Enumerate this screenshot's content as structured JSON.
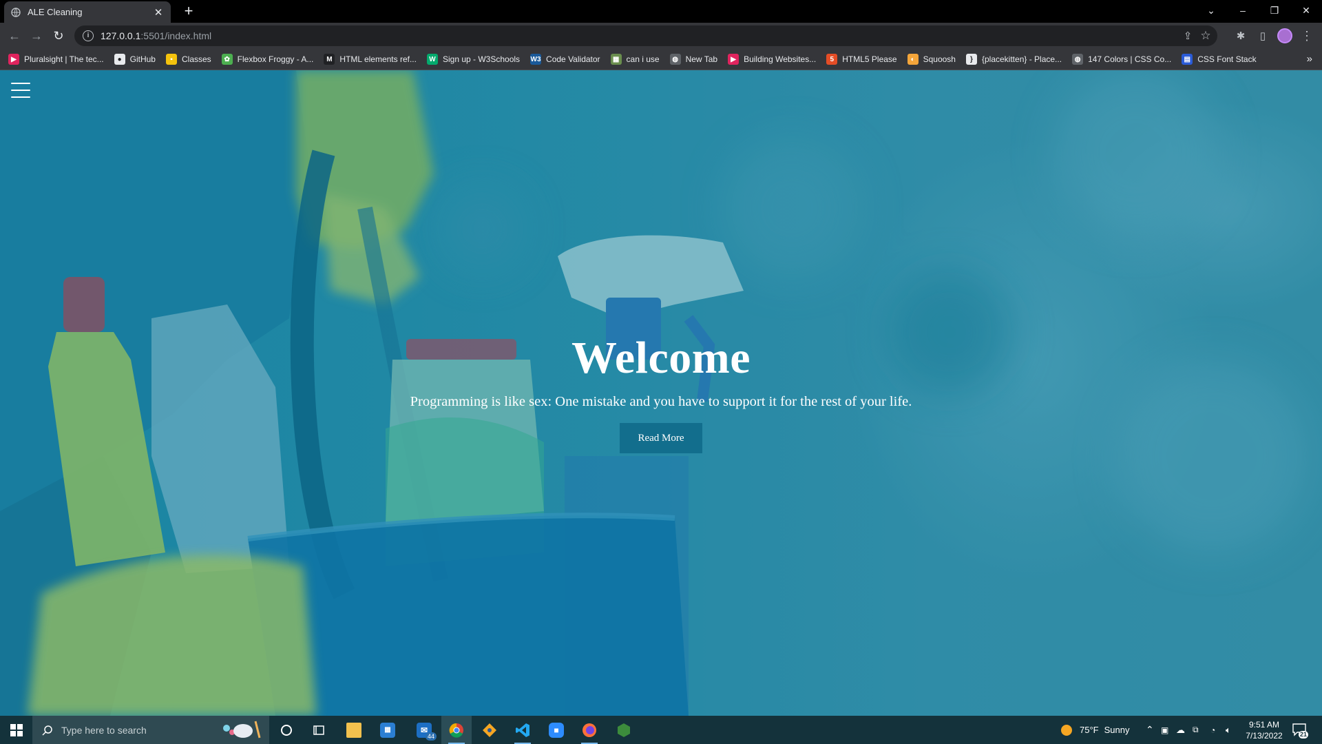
{
  "browser": {
    "tab": {
      "title": "ALE Cleaning",
      "close": "✕"
    },
    "new_tab": "+",
    "window_controls": {
      "dropdown": "⌄",
      "minimize": "–",
      "restore": "❐",
      "close": "✕"
    },
    "nav": {
      "back": "←",
      "forward": "→",
      "reload": "↻"
    },
    "address": {
      "host": "127.0.0.1",
      "path": ":5501/index.html"
    },
    "toolbar_icons": {
      "share": "⇪",
      "star": "☆",
      "extensions": "✱",
      "side_panel": "▯",
      "menu": "⋮"
    },
    "bookmarks": [
      {
        "label": "Pluralsight | The tec...",
        "icon": "pluralsight-icon",
        "color": "#e0245e",
        "glyph": "▶"
      },
      {
        "label": "GitHub",
        "icon": "github-icon",
        "color": "#e8eaed",
        "glyph": "●"
      },
      {
        "label": "Classes",
        "icon": "classes-icon",
        "color": "#f4c20d",
        "glyph": "▪"
      },
      {
        "label": "Flexbox Froggy - A...",
        "icon": "frog-icon",
        "color": "#4caf50",
        "glyph": "✿"
      },
      {
        "label": "HTML elements ref...",
        "icon": "mdn-icon",
        "color": "#202124",
        "glyph": "M"
      },
      {
        "label": "Sign up - W3Schools",
        "icon": "w3schools-icon",
        "color": "#04aa6d",
        "glyph": "W"
      },
      {
        "label": "Code Validator",
        "icon": "w3c-icon",
        "color": "#1a5a9a",
        "glyph": "W3"
      },
      {
        "label": "can i use",
        "icon": "caniuse-icon",
        "color": "#6a8e4e",
        "glyph": "▦"
      },
      {
        "label": "New Tab",
        "icon": "globe-icon",
        "color": "#5f6368",
        "glyph": "◍"
      },
      {
        "label": "Building Websites...",
        "icon": "course-icon",
        "color": "#e0245e",
        "glyph": "▶"
      },
      {
        "label": "HTML5 Please",
        "icon": "html5-icon",
        "color": "#e44d26",
        "glyph": "5"
      },
      {
        "label": "Squoosh",
        "icon": "squoosh-icon",
        "color": "#f4a53a",
        "glyph": "◐"
      },
      {
        "label": "{placekitten} - Place...",
        "icon": "placekitten-icon",
        "color": "#e8eaed",
        "glyph": "}"
      },
      {
        "label": "147 Colors | CSS Co...",
        "icon": "globe-icon",
        "color": "#5f6368",
        "glyph": "◍"
      },
      {
        "label": "CSS Font Stack",
        "icon": "fontstack-icon",
        "color": "#2a5bd7",
        "glyph": "▤"
      }
    ],
    "bookmarks_more": "»"
  },
  "page": {
    "hero": {
      "title": "Welcome",
      "subtitle": "Programming is like sex: One mistake and you have to support it for the rest of your life.",
      "button": "Read More"
    }
  },
  "taskbar": {
    "search_placeholder": "Type here to search",
    "mail_badge": "44",
    "weather": {
      "temp": "75°F",
      "condition": "Sunny"
    },
    "clock": {
      "time": "9:51 AM",
      "date": "7/13/2022"
    },
    "notifications": "21"
  },
  "colors": {
    "hero_button": "#126e8d",
    "page_tint": "#2b8fa9",
    "taskbar": "#14323b"
  }
}
